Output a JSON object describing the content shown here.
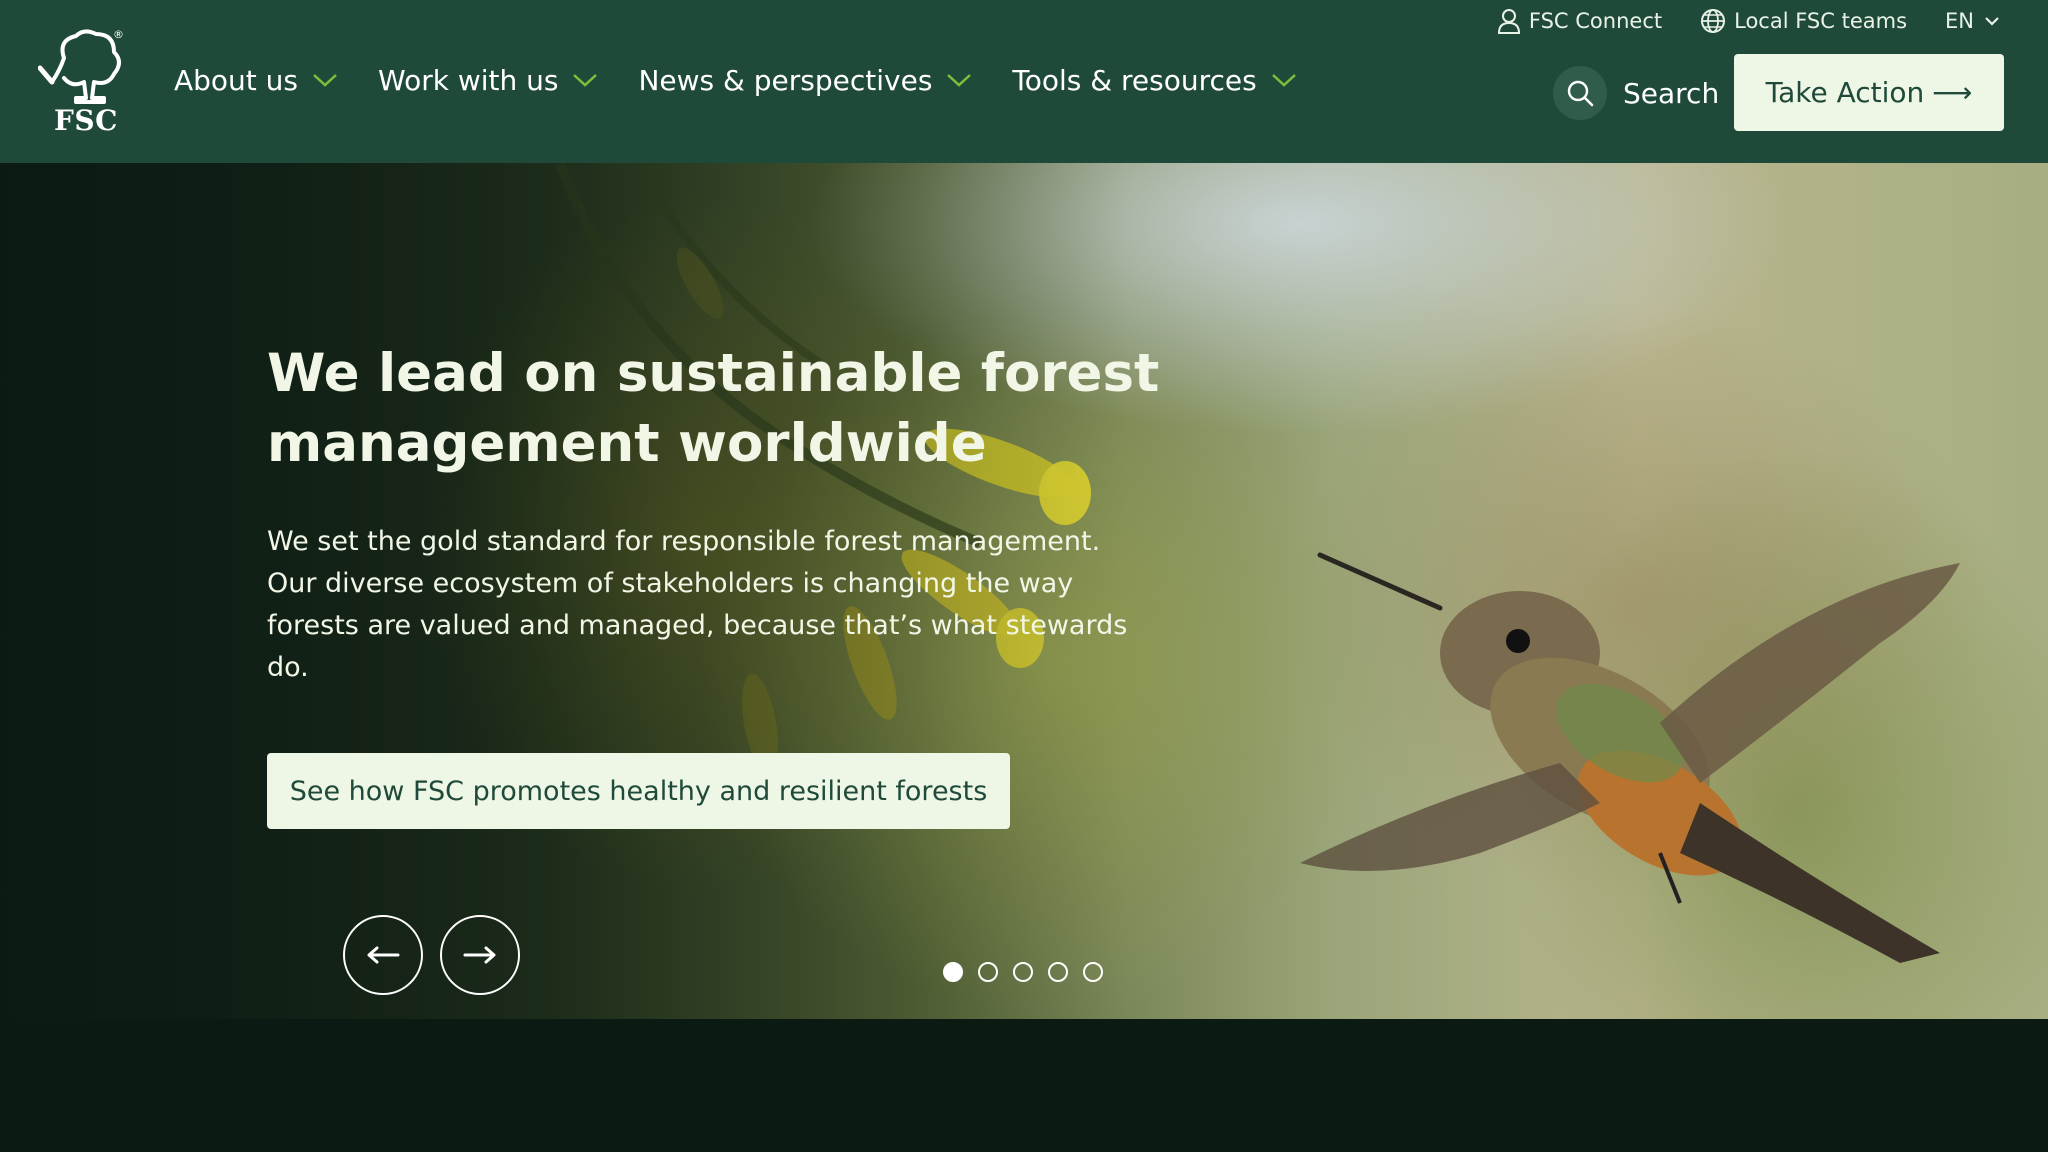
{
  "header": {
    "logo_text": "FSC",
    "logo_reg": "®",
    "nav": [
      {
        "label": "About us"
      },
      {
        "label": "Work with us"
      },
      {
        "label": "News & perspectives"
      },
      {
        "label": "Tools & resources"
      }
    ],
    "top_links": {
      "connect": "FSC Connect",
      "local_teams": "Local FSC teams",
      "language": "EN"
    },
    "search_label": "Search",
    "take_action": "Take Action",
    "take_action_arrow": "⟶"
  },
  "hero": {
    "title": "We lead on sustainable forest management worldwide",
    "text": "We set the gold standard for responsible forest management. Our diverse ecosystem of stakeholders is changing the way forests are valued and managed, because that’s what stewards do.",
    "cta": "See how FSC promotes healthy and resilient forests",
    "slides_total": 5,
    "active_slide": 1
  },
  "colors": {
    "header_bg": "#1f4a3a",
    "button_bg": "#eef6e6",
    "chevron": "#7bbf3a",
    "page_bg": "#0b1a13"
  }
}
